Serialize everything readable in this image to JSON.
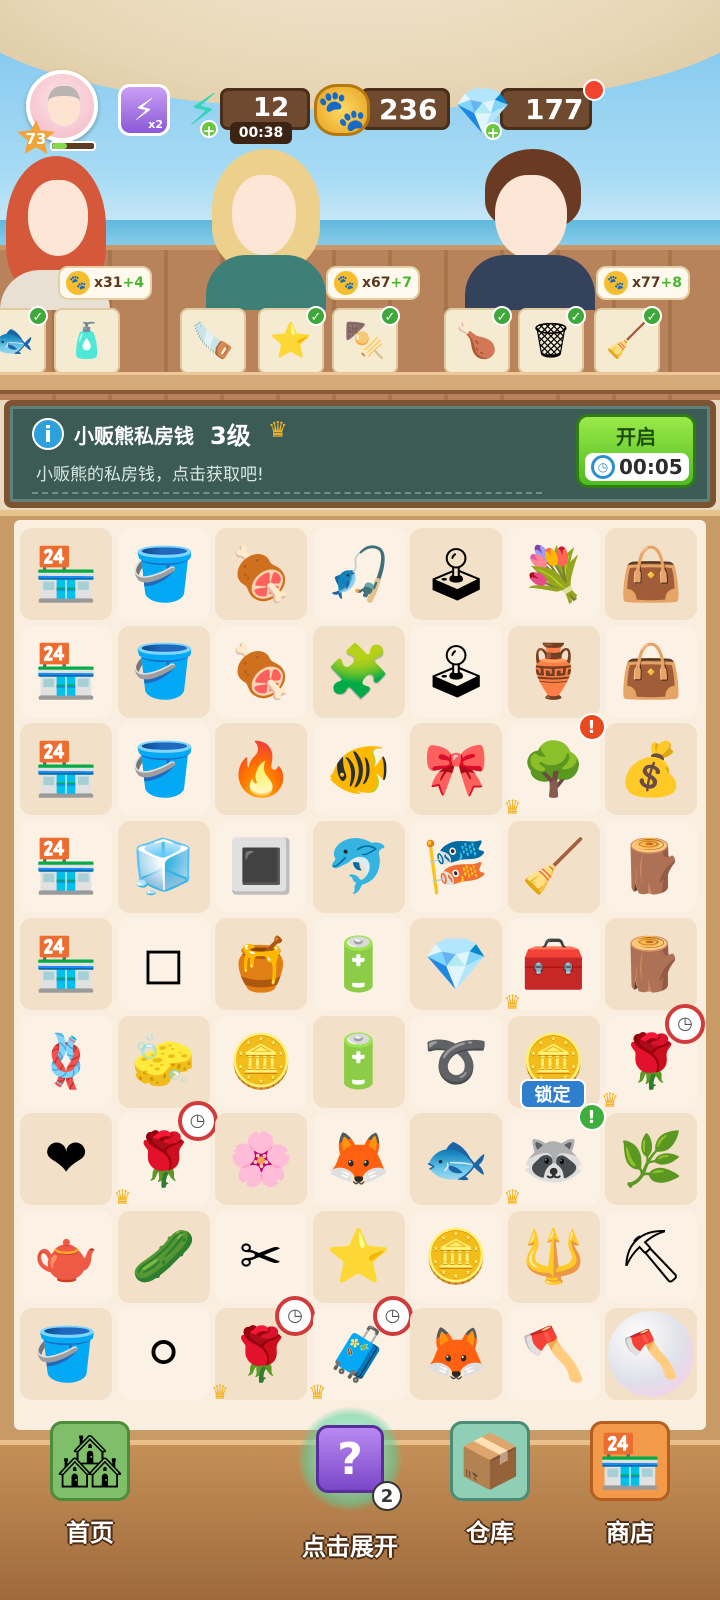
{
  "hud": {
    "player_level": "73",
    "xp_progress": 0.35,
    "boost_label": "x2",
    "energy": "12",
    "energy_timer": "00:38",
    "paws": "236",
    "gems": "177"
  },
  "customers": [
    {
      "cost": "x31",
      "bonus": "+4",
      "orders": [
        {
          "icon": "fish-icon",
          "glyph": "🐟",
          "done": true
        },
        {
          "icon": "detergent-bottle-icon",
          "glyph": "🧴",
          "done": false
        }
      ]
    },
    {
      "cost": "x67",
      "bonus": "+7",
      "orders": [
        {
          "icon": "saw-icon",
          "glyph": "🪚",
          "done": false
        },
        {
          "icon": "starfish-icon",
          "glyph": "⭐",
          "done": true
        },
        {
          "icon": "skewers-plate-icon",
          "glyph": "🍢",
          "done": true
        }
      ]
    },
    {
      "cost": "x77",
      "bonus": "+8",
      "orders": [
        {
          "icon": "grilled-food-plate-icon",
          "glyph": "🍗",
          "done": true
        },
        {
          "icon": "trash-bin-icon",
          "glyph": "🗑",
          "done": true
        },
        {
          "icon": "mop-icon",
          "glyph": "🧹",
          "done": true
        }
      ]
    }
  ],
  "quest": {
    "title": "小贩熊私房钱",
    "level": "3级",
    "description": "小贩熊的私房钱，点击获取吧!",
    "button_label": "开启",
    "button_timer": "00:05"
  },
  "board": {
    "rows": [
      [
        {
          "icon": "vending-machine-plant-icon",
          "glyph": "🏪"
        },
        {
          "icon": "tool-bucket-cart-icon",
          "glyph": "🪣"
        },
        {
          "icon": "bbq-grill-large-icon",
          "glyph": "🍖"
        },
        {
          "icon": "fishing-rod-icon",
          "glyph": "🎣"
        },
        {
          "icon": "claw-machine-icon",
          "glyph": "🕹"
        },
        {
          "icon": "flower-vase-large-icon",
          "glyph": "💐"
        },
        {
          "icon": "leather-bag-large-icon",
          "glyph": "👜"
        }
      ],
      [
        {
          "icon": "vending-machine-purple-plant-icon",
          "glyph": "🏪"
        },
        {
          "icon": "tool-bucket-icon",
          "glyph": "🪣"
        },
        {
          "icon": "bbq-grill-medium-icon",
          "glyph": "🍖"
        },
        {
          "icon": "tangram-board-icon",
          "glyph": "🧩"
        },
        {
          "icon": "claw-machine-pink-icon",
          "glyph": "🕹"
        },
        {
          "icon": "flower-vase-icon",
          "glyph": "🏺"
        },
        {
          "icon": "leather-bag-icon",
          "glyph": "👜"
        }
      ],
      [
        {
          "icon": "vending-machine-purple-icon",
          "glyph": "🏪"
        },
        {
          "icon": "wooden-bucket-icon",
          "glyph": "🪣"
        },
        {
          "icon": "bbq-grill-small-icon",
          "glyph": "🔥"
        },
        {
          "icon": "fish-bowl-icon",
          "glyph": "🐠"
        },
        {
          "icon": "pink-fabric-frame-icon",
          "glyph": "🎀"
        },
        {
          "icon": "money-tree-generator-icon",
          "glyph": "🌳",
          "crown": true,
          "alert": "!"
        },
        {
          "icon": "coin-pouch-icon",
          "glyph": "💰"
        }
      ],
      [
        {
          "icon": "vending-machine-pink-icon",
          "glyph": "🏪"
        },
        {
          "icon": "glass-box-icon",
          "glyph": "🧊"
        },
        {
          "icon": "charcoal-grill-tray-icon",
          "glyph": "🔳"
        },
        {
          "icon": "blue-fish-icon",
          "glyph": "🐬"
        },
        {
          "icon": "fishing-float-icon",
          "glyph": "🎏"
        },
        {
          "icon": "garden-rake-icon",
          "glyph": "🧹"
        },
        {
          "icon": "wood-planks-icon",
          "glyph": "🪵"
        }
      ],
      [
        {
          "icon": "vending-machine-small-icon",
          "glyph": "🏪"
        },
        {
          "icon": "glass-pane-icon",
          "glyph": "◻"
        },
        {
          "icon": "honey-pot-icon",
          "glyph": "🍯"
        },
        {
          "icon": "battery-large-icon",
          "glyph": "🔋"
        },
        {
          "icon": "blue-gem-icon",
          "glyph": "💎"
        },
        {
          "icon": "tackle-box-icon",
          "glyph": "🧰",
          "crown": true
        },
        {
          "icon": "wood-scraps-icon",
          "glyph": "🪵"
        }
      ],
      [
        {
          "icon": "rope-coil-icon",
          "glyph": "🪢"
        },
        {
          "icon": "folded-cloth-icon",
          "glyph": "🧽"
        },
        {
          "icon": "paw-coins-pile-icon",
          "glyph": "🪙"
        },
        {
          "icon": "battery-small-icon",
          "glyph": "🔋"
        },
        {
          "icon": "rope-piece-icon",
          "glyph": "➰"
        },
        {
          "icon": "paw-coins-icon",
          "glyph": "🪙"
        },
        {
          "icon": "rose-bouquet-icon",
          "glyph": "🌹",
          "crown": true,
          "timer": true
        }
      ],
      [
        {
          "icon": "rose-petals-heart-icon",
          "glyph": "❤"
        },
        {
          "icon": "rose-bouquet-icon",
          "glyph": "🌹",
          "crown": true,
          "timer": true
        },
        {
          "icon": "rose-petals-icon",
          "glyph": "🌸"
        },
        {
          "icon": "fox-sticker-icon",
          "glyph": "🦊"
        },
        {
          "icon": "green-fish-icon",
          "glyph": "🐟"
        },
        {
          "icon": "raccoon-vendor-icon",
          "glyph": "🦝",
          "crown": true,
          "locked": true,
          "alert_green": "!"
        },
        {
          "icon": "green-plant-icon",
          "glyph": "🌿"
        }
      ],
      [
        {
          "icon": "teapot-icon",
          "glyph": "🫖"
        },
        {
          "icon": "cucumber-slices-icon",
          "glyph": "🥒"
        },
        {
          "icon": "pruning-shears-icon",
          "glyph": "✂"
        },
        {
          "icon": "starfish-pair-icon",
          "glyph": "⭐"
        },
        {
          "icon": "paw-coin-icon",
          "glyph": "🪙"
        },
        {
          "icon": "garden-fork-icon",
          "glyph": "🔱"
        },
        {
          "icon": "garden-shovel-icon",
          "glyph": "⛏"
        }
      ],
      [
        {
          "icon": "covered-bucket-icon",
          "glyph": "🪣"
        },
        {
          "icon": "energy-token-icon",
          "glyph": "⚪"
        },
        {
          "icon": "rose-bouquet-icon",
          "glyph": "🌹",
          "crown": true,
          "timer": true
        },
        {
          "icon": "treasure-chest-icon",
          "glyph": "🧳",
          "crown": true,
          "timer": true
        },
        {
          "icon": "fox-wizard-sticker-icon",
          "glyph": "🦊"
        },
        {
          "icon": "axe-icon",
          "glyph": "🪓"
        },
        {
          "icon": "axe-in-bubble-icon",
          "glyph": "🪓",
          "bubble": true
        }
      ]
    ],
    "locked_label": "锁定"
  },
  "nav": {
    "home_label": "首页",
    "expand_label": "点击展开",
    "expand_count": "2",
    "storage_label": "仓库",
    "shop_label": "商店"
  }
}
